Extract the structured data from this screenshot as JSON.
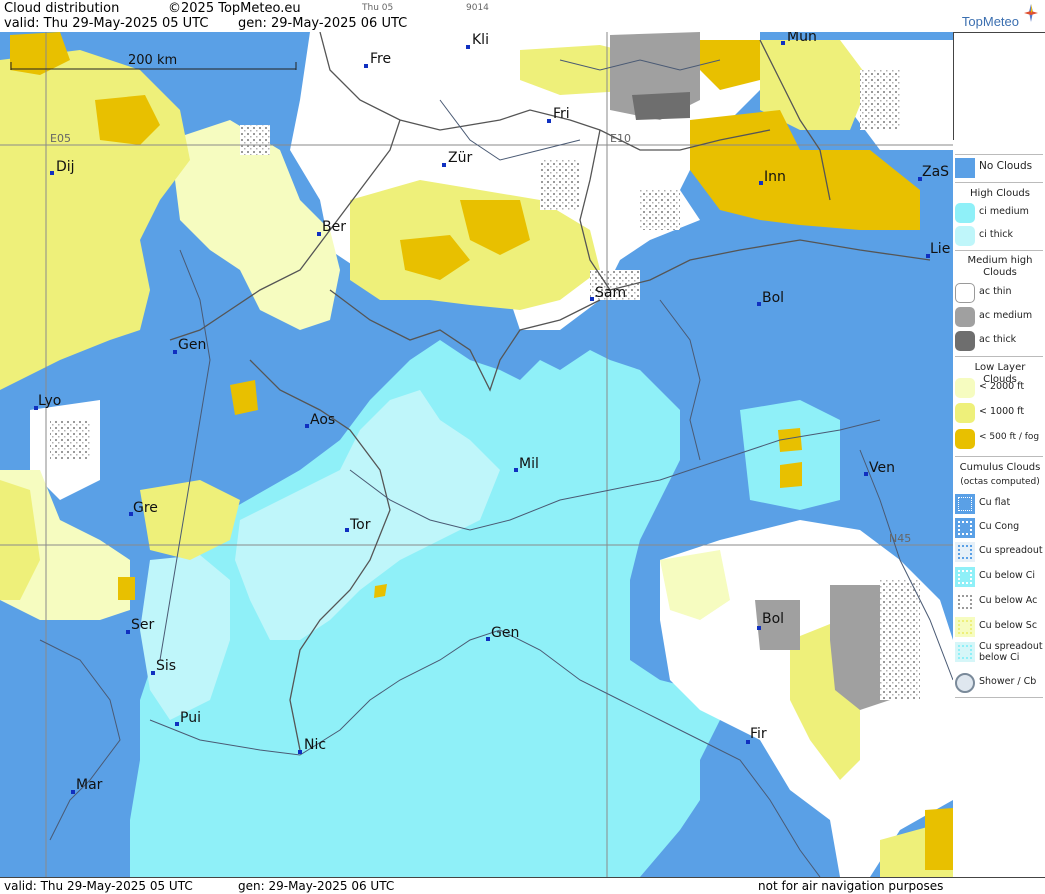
{
  "header": {
    "title": "Cloud distribution",
    "copyright": "©2025 TopMeteo.eu",
    "valid": "valid:  Thu  29-May-2025  05 UTC",
    "gen": "gen: 29-May-2025 06 UTC",
    "day_code": "Thu 05",
    "run_code": "9014",
    "brand": "TopMeteo"
  },
  "footer": {
    "valid": "valid:  Thu  29-May-2025  05 UTC",
    "gen": "gen: 29-May-2025 06 UTC",
    "note": "not for air navigation purposes"
  },
  "map": {
    "scale_label": "200 km",
    "grid_labels": [
      "E05",
      "E10",
      "N45"
    ],
    "cities": [
      "Kli",
      "Mün",
      "Fre",
      "Fri",
      "Dij",
      "Zür",
      "Inn",
      "ZaS",
      "Ber",
      "Lie",
      "Sam",
      "Bol",
      "Gen",
      "Lyo",
      "Aos",
      "Mil",
      "Ven",
      "Gre",
      "Tor",
      "Ser",
      "Gen",
      "Bol",
      "Sis",
      "Pui",
      "Fir",
      "Nic",
      "Mar"
    ]
  },
  "legend": {
    "no_clouds": "No Clouds",
    "high_clouds": "High Clouds",
    "ci_medium": "ci medium",
    "ci_thick": "ci thick",
    "medium_high": "Medium high Clouds",
    "ac_thin": "ac thin",
    "ac_medium": "ac medium",
    "ac_thick": "ac thick",
    "low_layer": "Low Layer Clouds",
    "lt2000": "< 2000 ft",
    "lt1000": "< 1000 ft",
    "lt500": "< 500 ft / fog",
    "cumulus": "Cumulus Clouds",
    "cumulus_sub": "(octas computed)",
    "cu_flat": "Cu flat",
    "cu_cong": "Cu Cong",
    "cu_spreadout": "Cu spreadout",
    "cu_below_ci": "Cu below Ci",
    "cu_below_ac": "Cu below Ac",
    "cu_below_sc": "Cu below Sc",
    "cu_spreadout_below_ci": "Cu spreadout below Ci",
    "shower": "Shower / Cb"
  },
  "colors": {
    "no_clouds": "#5aa0e6",
    "ci_medium": "#8ff0f8",
    "ci_thick": "#bff6fa",
    "ac_thin": "#ffffff",
    "ac_medium": "#a0a0a0",
    "ac_thick": "#6e6e6e",
    "low_2000": "#f6fcc0",
    "low_1000": "#eef07a",
    "low_500": "#e8c000"
  }
}
